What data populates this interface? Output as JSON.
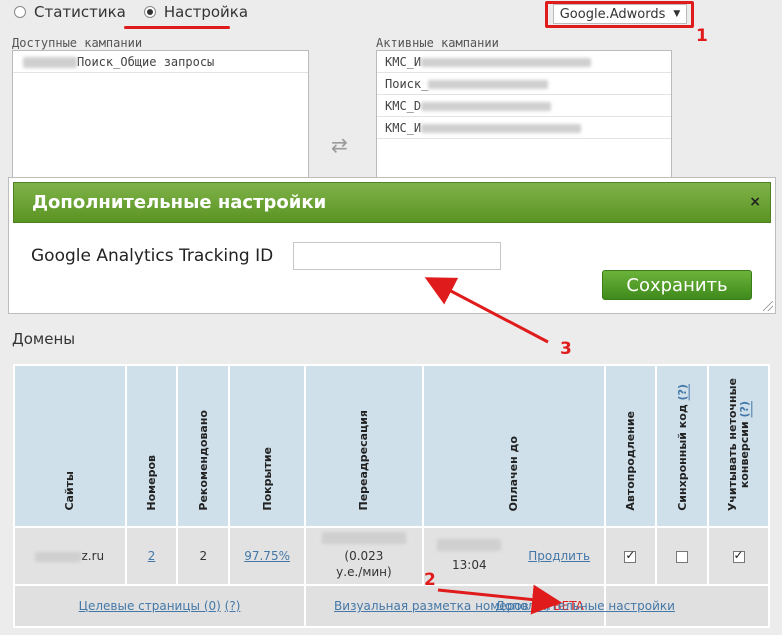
{
  "header": {
    "radio_statistics": "Статистика",
    "radio_settings": "Настройка",
    "platform_dropdown": "Google.Adwords"
  },
  "callouts": {
    "one": "1",
    "two": "2",
    "three": "3"
  },
  "available": {
    "title": "Доступные кампании",
    "items": [
      "Поиск_Общие запросы"
    ]
  },
  "active": {
    "title": "Активные кампании",
    "items": [
      "КМС_И",
      "Поиск_",
      "КМС_D",
      "КМС_И"
    ]
  },
  "modal": {
    "title": "Дополнительные настройки",
    "close": "×",
    "ga_label": "Google Analytics Tracking ID",
    "ga_value": "",
    "save": "Сохранить"
  },
  "domains": {
    "title": "Домены",
    "headers": {
      "sites": "Сайты",
      "numbers": "Номеров",
      "recommended": "Рекомендовано",
      "coverage": "Покрытие",
      "redirect": "Переадресация",
      "paid_until": "Оплачен до",
      "autorenew": "Автопродление",
      "sync_code": "Синхронный код",
      "sync_help": "(?)",
      "fuzzy_1": "Учитывать неточные",
      "fuzzy_2": "конверсии",
      "fuzzy_help": "(?)"
    },
    "row": {
      "site": "z.ru",
      "numbers": "2",
      "recommended": "2",
      "coverage": "97.75%",
      "redirect_rate": "(0.023",
      "redirect_unit": "у.е./мин)",
      "paid_time": "13:04",
      "renew_link": "Продлить",
      "autorenew_checked": true,
      "sync_checked": false,
      "fuzzy_checked": true
    },
    "footer": {
      "target_pages": "Целевые страницы (0)",
      "target_help": "(?)",
      "visual_markup": "Визуальная разметка номеров (0)",
      "beta": "BETA",
      "extra_settings": "Дополнительные настройки"
    }
  },
  "colors": {
    "accent_red": "#e01b1b",
    "header_green": "#5a9422",
    "link_blue": "#4478a8"
  }
}
